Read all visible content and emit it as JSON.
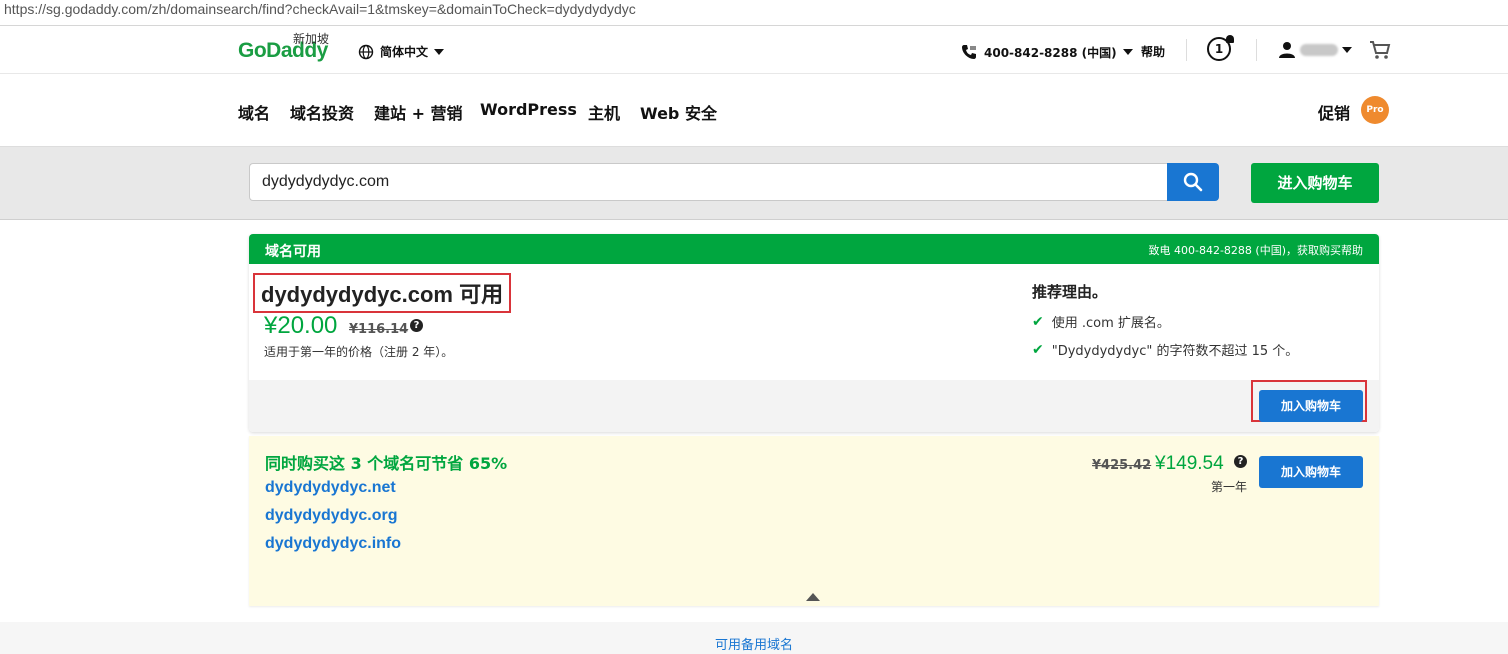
{
  "browser": {
    "url": "https://sg.godaddy.com/zh/domainsearch/find?checkAvail=1&tmskey=&domainToCheck=dydydydydyc"
  },
  "header": {
    "logo_text": "GoDaddy",
    "logo_region": "新加坡",
    "language": "简体中文",
    "phone": "400-842-8288 (中国)",
    "help": "帮助",
    "notification_count": "1"
  },
  "nav": {
    "items": [
      "域名",
      "域名投资",
      "建站 + 营销",
      "WordPress",
      "主机",
      "Web 安全"
    ],
    "promo": "促销",
    "pro_badge": "Pro"
  },
  "search": {
    "value": "dydydydydyc.com",
    "go_to_cart": "进入购物车"
  },
  "result": {
    "status": "域名可用",
    "phone_help": "致电 400-842-8288 (中国)，获取购买帮助",
    "domain_title": "dydydydydyc.com 可用",
    "price": "¥20.00",
    "old_price": "¥116.14",
    "price_note": "适用于第一年的价格（注册 2 年）。",
    "reasons_title": "推荐理由。",
    "reasons": [
      "使用 .com 扩展名。",
      "\"Dydydydydyc\" 的字符数不超过 15 个。"
    ],
    "add_to_cart": "加入购物车"
  },
  "bundle": {
    "title": "同时购买这 3 个域名可节省 65%",
    "domains": [
      "dydydydydyc.net",
      "dydydydydyc.org",
      "dydydydydyc.info"
    ],
    "old_price": "¥425.42",
    "price": "¥149.54",
    "period": "第一年",
    "add_to_cart": "加入购物车"
  },
  "footer": {
    "link": "可用备用域名"
  },
  "colors": {
    "brand_green": "#00a63f",
    "brand_blue": "#1976d2",
    "highlight_red": "#d9343a",
    "promo_orange": "#ef8a2e"
  }
}
